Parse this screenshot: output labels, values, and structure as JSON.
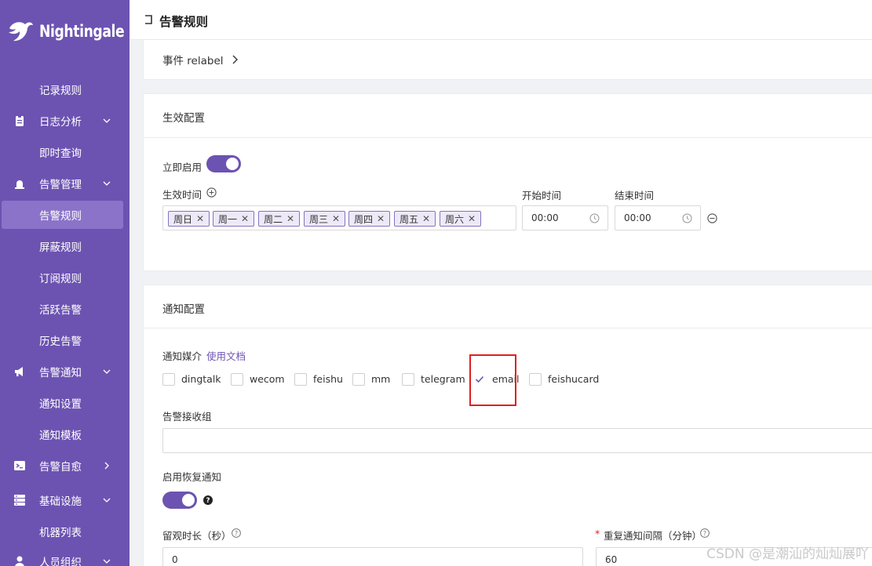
{
  "app": {
    "name": "Nightingale"
  },
  "sidebar": {
    "items": [
      {
        "label": "记录规则"
      },
      {
        "label": "日志分析"
      },
      {
        "label": "即时查询"
      },
      {
        "label": "告警管理"
      },
      {
        "label": "告警规则"
      },
      {
        "label": "屏蔽规则"
      },
      {
        "label": "订阅规则"
      },
      {
        "label": "活跃告警"
      },
      {
        "label": "历史告警"
      },
      {
        "label": "告警通知"
      },
      {
        "label": "通知设置"
      },
      {
        "label": "通知模板"
      },
      {
        "label": "告警自愈"
      },
      {
        "label": "基础设施"
      },
      {
        "label": "机器列表"
      },
      {
        "label": "人员组织"
      }
    ]
  },
  "header": {
    "title": "告警规则"
  },
  "relabel": {
    "label": "事件 relabel"
  },
  "effective": {
    "section_title": "生效配置",
    "enable_label": "立即启用",
    "enabled": true,
    "time_label": "生效时间",
    "days": [
      "周日",
      "周一",
      "周二",
      "周三",
      "周四",
      "周五",
      "周六"
    ],
    "start_label": "开始时间",
    "end_label": "结束时间",
    "start_value": "00:00",
    "end_value": "00:00"
  },
  "notify": {
    "section_title": "通知配置",
    "media_label": "通知媒介",
    "doc_link": "使用文档",
    "channels": [
      {
        "label": "dingtalk",
        "checked": false
      },
      {
        "label": "wecom",
        "checked": false
      },
      {
        "label": "feishu",
        "checked": false
      },
      {
        "label": "mm",
        "checked": false
      },
      {
        "label": "telegram",
        "checked": false
      },
      {
        "label": "email",
        "checked": true
      },
      {
        "label": "feishucard",
        "checked": false
      }
    ],
    "receiver_label": "告警接收组",
    "recovery_label": "启用恢复通知",
    "recovery_enabled": true,
    "observe_label": "留观时长（秒）",
    "observe_value": "0",
    "repeat_required": "*",
    "repeat_label": "重复通知间隔（分钟）",
    "repeat_value": "60"
  },
  "watermark": "CSDN @是潮汕的灿灿展吖",
  "colors": {
    "accent": "#6c53b1",
    "sidebar_active": "#8a73c9",
    "highlight": "#e02020"
  }
}
